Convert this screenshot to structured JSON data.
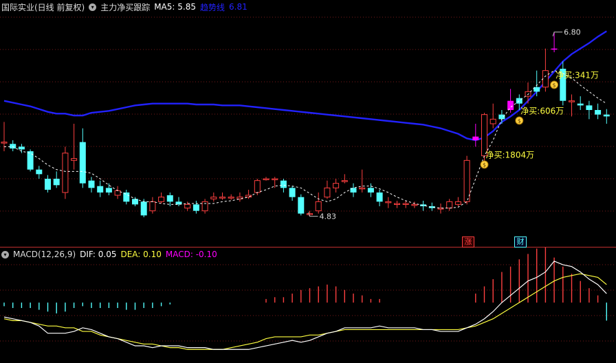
{
  "header": {
    "stock": "国际实业(日线 前复权)",
    "indicator": "主力净买跟踪",
    "ma5_label": "MA5: 5.85",
    "trend_label": "趋势线",
    "trend_value": "6.81"
  },
  "macd_header": {
    "title": "MACD(12,26,9)",
    "dif": "DIF: 0.05",
    "dea": "DEA: 0.10",
    "macd": "MACD: -0.10"
  },
  "price_labels": {
    "high": "6.80",
    "low": "4.83"
  },
  "net_buy_labels": [
    "净买:1804万",
    "净买:606万",
    "净买:341万"
  ],
  "markers": {
    "zhang": "涨",
    "cai": "财"
  },
  "colors": {
    "up": "#ff4040",
    "down": "#54ffff",
    "trend": "#2222ff",
    "ma5": "#ffffff",
    "highlight": "#ff00ff",
    "dea": "#ffff40",
    "grid": "#7a1a1a",
    "net_buy_text": "#ffff40"
  },
  "chart_data": {
    "type": "candlestick",
    "price_range": [
      4.6,
      7.0
    ],
    "candles": [
      [
        5.6,
        5.6,
        5.82,
        5.5
      ],
      [
        5.58,
        5.53,
        5.62,
        5.5
      ],
      [
        5.55,
        5.52,
        5.58,
        5.48
      ],
      [
        5.5,
        5.3,
        5.52,
        5.28
      ],
      [
        5.3,
        5.25,
        5.34,
        5.2
      ],
      [
        5.2,
        5.08,
        5.24,
        5.05
      ],
      [
        5.2,
        5.13,
        5.28,
        5.1
      ],
      [
        5.05,
        5.48,
        5.55,
        4.98
      ],
      [
        5.4,
        5.42,
        5.8,
        5.3
      ],
      [
        5.6,
        5.15,
        5.75,
        5.1
      ],
      [
        5.18,
        5.1,
        5.22,
        5.05
      ],
      [
        5.12,
        5.05,
        5.18,
        5.0
      ],
      [
        5.1,
        5.05,
        5.15,
        5.02
      ],
      [
        5.02,
        5.07,
        5.12,
        4.98
      ],
      [
        5.05,
        4.95,
        5.08,
        4.92
      ],
      [
        4.98,
        4.92,
        5.0,
        4.9
      ],
      [
        4.95,
        4.8,
        4.98,
        4.78
      ],
      [
        4.85,
        4.95,
        5.0,
        4.82
      ],
      [
        4.95,
        5.0,
        5.05,
        4.93
      ],
      [
        5.02,
        4.95,
        5.05,
        4.9
      ],
      [
        4.95,
        4.92,
        5.0,
        4.9
      ],
      [
        4.88,
        4.92,
        4.95,
        4.85
      ],
      [
        4.92,
        4.85,
        4.96,
        4.82
      ],
      [
        4.85,
        4.95,
        4.98,
        4.82
      ],
      [
        4.98,
        5.0,
        5.05,
        4.95
      ],
      [
        5.0,
        5.0,
        5.05,
        4.97
      ],
      [
        5.0,
        5.0,
        5.03,
        4.97
      ],
      [
        4.98,
        5.0,
        5.05,
        4.95
      ],
      [
        5.0,
        5.02,
        5.08,
        4.98
      ],
      [
        5.05,
        5.18,
        5.2,
        5.02
      ],
      [
        5.2,
        5.2,
        5.22,
        5.18
      ],
      [
        5.2,
        5.2,
        5.22,
        5.1
      ],
      [
        5.18,
        5.1,
        5.2,
        5.05
      ],
      [
        5.1,
        5.0,
        5.12,
        4.96
      ],
      [
        5.0,
        4.82,
        5.03,
        4.8
      ],
      [
        4.82,
        4.82,
        4.85,
        4.79
      ],
      [
        4.85,
        4.95,
        5.05,
        4.82
      ],
      [
        5.0,
        5.1,
        5.18,
        4.98
      ],
      [
        5.1,
        5.15,
        5.2,
        5.05
      ],
      [
        5.18,
        5.18,
        5.25,
        5.15
      ],
      [
        5.1,
        5.05,
        5.15,
        5.0
      ],
      [
        5.1,
        5.1,
        5.3,
        5.05
      ],
      [
        5.1,
        5.05,
        5.15,
        5.0
      ],
      [
        5.05,
        4.95,
        5.08,
        4.9
      ],
      [
        4.95,
        4.95,
        5.0,
        4.88
      ],
      [
        4.93,
        4.93,
        4.96,
        4.88
      ],
      [
        4.93,
        4.93,
        4.96,
        4.88
      ],
      [
        4.92,
        4.92,
        4.95,
        4.88
      ],
      [
        4.92,
        4.9,
        4.96,
        4.85
      ],
      [
        4.9,
        4.88,
        4.94,
        4.85
      ],
      [
        4.88,
        4.88,
        4.93,
        4.82
      ],
      [
        4.88,
        4.95,
        4.98,
        4.85
      ],
      [
        4.92,
        4.95,
        5.0,
        4.9
      ],
      [
        4.95,
        5.4,
        5.45,
        4.92
      ],
      [
        5.62,
        5.66,
        5.8,
        5.55
      ],
      [
        5.45,
        5.9,
        5.92,
        5.4
      ],
      [
        5.8,
        5.85,
        6.02,
        5.75
      ],
      [
        5.9,
        5.85,
        5.95,
        5.8
      ],
      [
        5.95,
        6.05,
        6.18,
        5.92
      ],
      [
        6.08,
        6.02,
        6.12,
        5.95
      ],
      [
        6.1,
        6.15,
        6.25,
        6.02
      ],
      [
        6.2,
        6.15,
        6.38,
        6.1
      ],
      [
        6.2,
        6.38,
        6.62,
        6.15
      ],
      [
        6.62,
        6.62,
        6.8,
        6.58
      ],
      [
        6.4,
        6.05,
        6.48,
        6.0
      ],
      [
        6.05,
        6.05,
        6.12,
        5.88
      ],
      [
        6.02,
        6.0,
        6.1,
        5.95
      ],
      [
        6.0,
        5.95,
        6.05,
        5.85
      ],
      [
        5.95,
        5.9,
        6.02,
        5.85
      ],
      [
        5.9,
        5.88,
        5.96,
        5.8
      ]
    ],
    "highlighted_indices": [
      54,
      58,
      63
    ],
    "ma5": [
      5.55,
      5.55,
      5.5,
      5.48,
      5.42,
      5.35,
      5.3,
      5.28,
      5.28,
      5.28,
      5.26,
      5.2,
      5.13,
      5.07,
      5.03,
      4.98,
      4.95,
      4.95,
      4.93,
      4.92,
      4.92,
      4.93,
      4.93,
      4.93,
      4.93,
      4.95,
      4.96,
      4.98,
      5.0,
      5.05,
      5.08,
      5.12,
      5.13,
      5.12,
      5.1,
      5.04,
      4.98,
      4.95,
      4.98,
      5.05,
      5.1,
      5.12,
      5.12,
      5.09,
      5.05,
      5.0,
      4.96,
      4.93,
      4.91,
      4.89,
      4.88,
      4.88,
      4.89,
      4.95,
      5.2,
      5.45,
      5.62,
      5.85,
      5.98,
      6.05,
      6.12,
      6.22,
      6.32,
      6.38,
      6.35,
      6.3,
      6.22,
      6.15,
      6.08,
      6.02
    ],
    "trend": [
      6.05,
      6.03,
      6.01,
      5.99,
      5.96,
      5.93,
      5.91,
      5.91,
      5.89,
      5.89,
      5.92,
      5.93,
      5.94,
      5.96,
      5.98,
      6.0,
      6.01,
      6.02,
      6.02,
      6.02,
      6.02,
      6.02,
      6.01,
      6.01,
      6.01,
      6.0,
      6.0,
      6.0,
      5.99,
      5.98,
      5.97,
      5.96,
      5.95,
      5.94,
      5.93,
      5.92,
      5.91,
      5.9,
      5.89,
      5.88,
      5.87,
      5.86,
      5.85,
      5.84,
      5.83,
      5.82,
      5.81,
      5.8,
      5.79,
      5.77,
      5.75,
      5.72,
      5.69,
      5.64,
      5.62,
      5.65,
      5.72,
      5.82,
      5.88,
      5.95,
      6.05,
      6.15,
      6.26,
      6.37,
      6.48,
      6.56,
      6.62,
      6.68,
      6.75,
      6.81
    ],
    "macd_range": [
      -0.32,
      0.26
    ],
    "dif": [
      -0.08,
      -0.09,
      -0.1,
      -0.11,
      -0.13,
      -0.17,
      -0.17,
      -0.17,
      -0.16,
      -0.14,
      -0.15,
      -0.17,
      -0.19,
      -0.2,
      -0.22,
      -0.24,
      -0.24,
      -0.25,
      -0.24,
      -0.24,
      -0.24,
      -0.25,
      -0.25,
      -0.25,
      -0.26,
      -0.26,
      -0.26,
      -0.26,
      -0.26,
      -0.25,
      -0.24,
      -0.23,
      -0.22,
      -0.21,
      -0.22,
      -0.21,
      -0.19,
      -0.17,
      -0.16,
      -0.14,
      -0.14,
      -0.14,
      -0.14,
      -0.13,
      -0.14,
      -0.14,
      -0.14,
      -0.14,
      -0.15,
      -0.15,
      -0.16,
      -0.16,
      -0.16,
      -0.14,
      -0.12,
      -0.09,
      -0.05,
      0.0,
      0.04,
      0.08,
      0.12,
      0.14,
      0.17,
      0.23,
      0.21,
      0.2,
      0.17,
      0.13,
      0.1,
      0.05
    ],
    "dea": [
      -0.09,
      -0.1,
      -0.1,
      -0.11,
      -0.12,
      -0.13,
      -0.13,
      -0.14,
      -0.14,
      -0.16,
      -0.16,
      -0.18,
      -0.19,
      -0.2,
      -0.21,
      -0.22,
      -0.23,
      -0.23,
      -0.24,
      -0.25,
      -0.25,
      -0.26,
      -0.26,
      -0.26,
      -0.26,
      -0.26,
      -0.25,
      -0.24,
      -0.23,
      -0.22,
      -0.2,
      -0.19,
      -0.19,
      -0.19,
      -0.19,
      -0.18,
      -0.18,
      -0.17,
      -0.16,
      -0.15,
      -0.15,
      -0.15,
      -0.15,
      -0.15,
      -0.15,
      -0.15,
      -0.15,
      -0.15,
      -0.15,
      -0.15,
      -0.15,
      -0.15,
      -0.15,
      -0.14,
      -0.13,
      -0.11,
      -0.09,
      -0.06,
      -0.03,
      0.0,
      0.03,
      0.06,
      0.09,
      0.12,
      0.14,
      0.15,
      0.16,
      0.15,
      0.14,
      0.1
    ],
    "macd_bars": [
      -0.02,
      -0.03,
      -0.03,
      -0.03,
      -0.04,
      -0.05,
      -0.06,
      -0.05,
      -0.03,
      -0.02,
      -0.03,
      -0.03,
      -0.03,
      -0.03,
      -0.04,
      -0.04,
      -0.03,
      -0.03,
      -0.02,
      -0.01,
      0.0,
      0.0,
      0.0,
      0.0,
      0.0,
      0.0,
      0.0,
      0.0,
      0.0,
      0.0,
      0.02,
      0.03,
      0.03,
      0.05,
      0.07,
      0.08,
      0.09,
      0.1,
      0.09,
      0.07,
      0.05,
      0.04,
      0.02,
      0.02,
      0.0,
      0.0,
      0.0,
      0.0,
      0.0,
      0.0,
      0.0,
      0.0,
      0.0,
      0.0,
      0.05,
      0.09,
      0.13,
      0.17,
      0.2,
      0.24,
      0.27,
      0.3,
      0.32,
      0.25,
      0.2,
      0.16,
      0.12,
      0.08,
      0.04,
      -0.1
    ]
  }
}
